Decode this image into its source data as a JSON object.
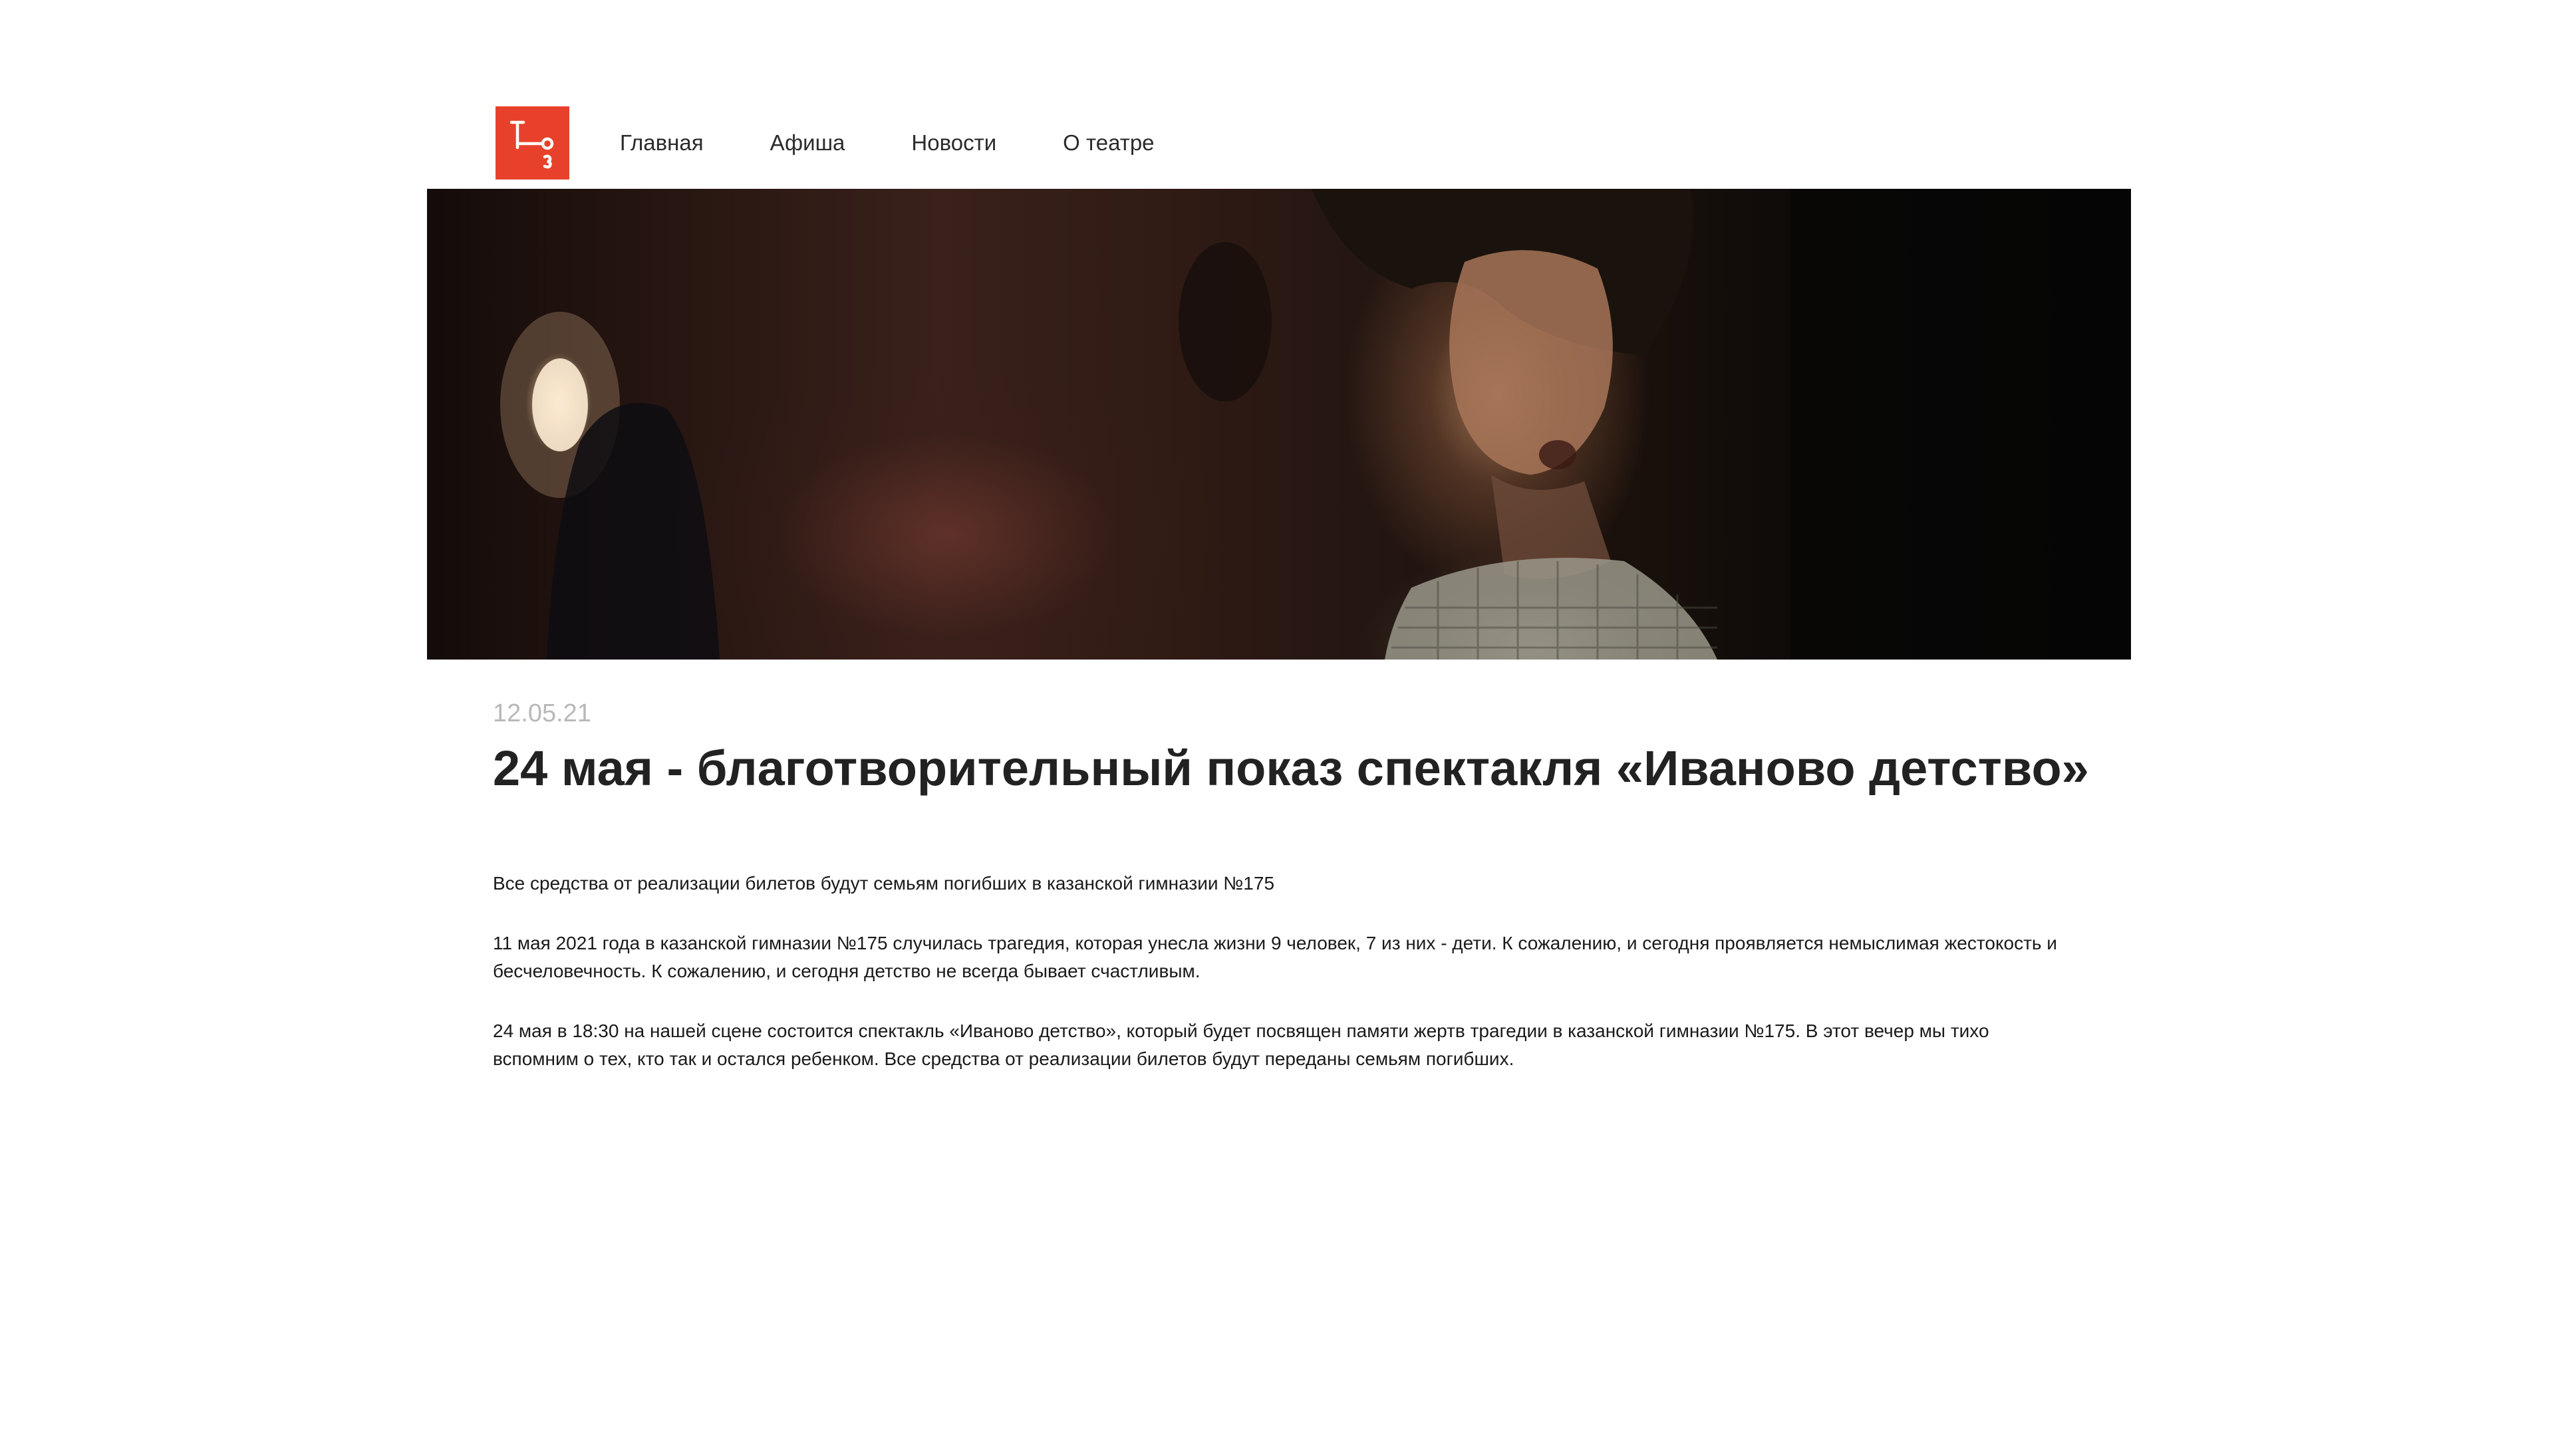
{
  "logo": {
    "icon": "theatre-logo-icon",
    "color": "#e8412b"
  },
  "nav": {
    "items": [
      {
        "label": "Главная"
      },
      {
        "label": "Афиша"
      },
      {
        "label": "Новости"
      },
      {
        "label": "О театре"
      }
    ]
  },
  "article": {
    "date": "12.05.21",
    "title": "24 мая - благотворительный показ спектакля «Иваново детство»",
    "paragraphs": [
      "Все средства от реализации билетов будут семьям погибших в казанской гимназии №175",
      "11 мая 2021 года в казанской гимназии №175 случилась трагедия, которая унесла жизни 9 человек, 7 из них - дети. К сожалению, и сегодня проявляется немыслимая жестокость и бесчеловечность. К сожалению, и сегодня детство не всегда бывает счастливым.",
      "24 мая в 18:30 на нашей сцене состоится спектакль «Иваново детство», который будет посвящен памяти жертв трагедии в казанской гимназии №175. В этот вечер мы тихо вспомним о тех, кто так и остался ребенком. Все средства от реализации билетов будут переданы семьям погибших."
    ]
  }
}
